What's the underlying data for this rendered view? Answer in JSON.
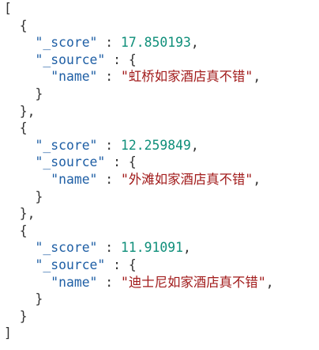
{
  "json": {
    "open_array": "[",
    "close_array": "]",
    "open_obj": "{",
    "close_obj": "}",
    "close_obj_comma": "},",
    "open_source": "{",
    "close_source": "}",
    "colon": " : ",
    "comma": ",",
    "keys": {
      "score": "\"_score\"",
      "source": "\"_source\"",
      "name": "\"name\""
    },
    "results": [
      {
        "score": "17.850193",
        "name": "\"虹桥如家酒店真不错\""
      },
      {
        "score": "12.259849",
        "name": "\"外滩如家酒店真不错\""
      },
      {
        "score": "11.91091",
        "name": "\"迪士尼如家酒店真不错\""
      }
    ]
  }
}
